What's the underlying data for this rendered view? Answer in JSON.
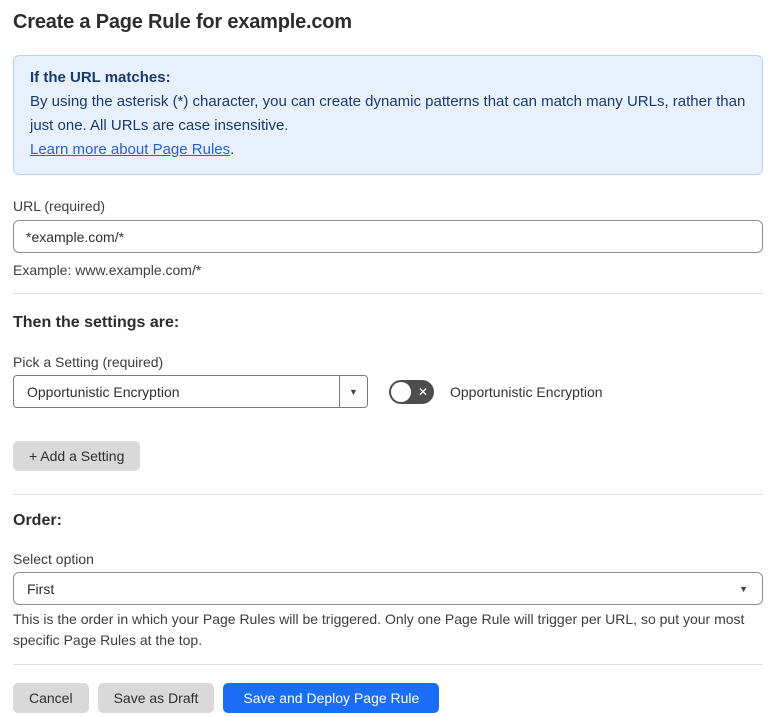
{
  "page": {
    "title": "Create a Page Rule for example.com"
  },
  "info_box": {
    "heading": "If the URL matches:",
    "body": "By using the asterisk (*) character, you can create dynamic patterns that can match many URLs, rather than just one. All URLs are case insensitive.",
    "link_label": "Learn more about Page Rules",
    "link_suffix": "."
  },
  "url_field": {
    "label": "URL (required)",
    "value": "*example.com/*",
    "help": "Example: www.example.com/*"
  },
  "settings_section": {
    "heading": "Then the settings are:",
    "picker_label": "Pick a Setting (required)",
    "picker_value": "Opportunistic Encryption",
    "toggle_state": "off",
    "toggle_label": "Opportunistic Encryption",
    "add_button_label": "+ Add a Setting"
  },
  "order_section": {
    "heading": "Order:",
    "select_label": "Select option",
    "select_value": "First",
    "help": "This is the order in which your Page Rules will be triggered. Only one Page Rule will trigger per URL, so put your most specific Page Rules at the top."
  },
  "footer": {
    "cancel_label": "Cancel",
    "save_draft_label": "Save as Draft",
    "deploy_label": "Save and Deploy Page Rule"
  },
  "icons": {
    "caret_down": "▼",
    "toggle_x": "✕"
  },
  "colors": {
    "accent_blue": "#1a6ef5",
    "info_bg": "#e8f1fb",
    "info_border": "#b5d3f2",
    "info_text": "#1a3a6b",
    "link_blue": "#2a62c9",
    "toggle_off_bg": "#4d4d4d",
    "button_gray": "#d9d9d9"
  }
}
